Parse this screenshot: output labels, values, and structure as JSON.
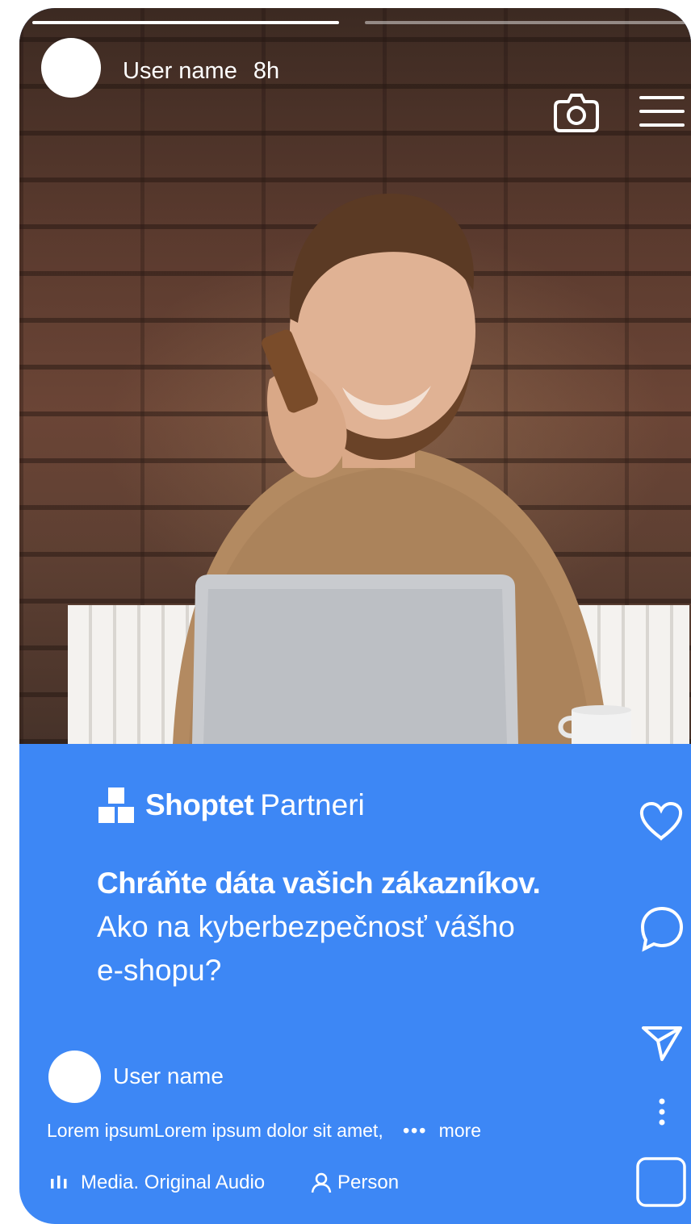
{
  "header": {
    "user_name": "User name",
    "time_ago": "8h"
  },
  "story": {
    "progress": [
      1.0,
      0.0
    ]
  },
  "brand": {
    "name_bold": "Shoptet",
    "name_regular": "Partneri"
  },
  "headline": {
    "title": "Chráňte dáta vašich zákazníkov.",
    "subtitle_line1": "Ako na kyberbezpečnosť vášho",
    "subtitle_line2": "e-shopu?"
  },
  "post": {
    "user_name": "User name",
    "description": "Lorem ipsumLorem ipsum dolor sit amet,",
    "more_label": "more",
    "audio_label": "Media. Original Audio",
    "person_label": "Person"
  },
  "icons": {
    "camera": "camera-icon",
    "menu": "hamburger-menu-icon",
    "like": "heart-icon",
    "comment": "comment-bubble-icon",
    "share": "send-icon",
    "options": "more-vertical-icon",
    "audio": "audio-bars-icon",
    "person": "person-icon",
    "thumb": "square-thumbnail-icon"
  },
  "colors": {
    "panel": "#3d87f5",
    "text": "#ffffff"
  }
}
